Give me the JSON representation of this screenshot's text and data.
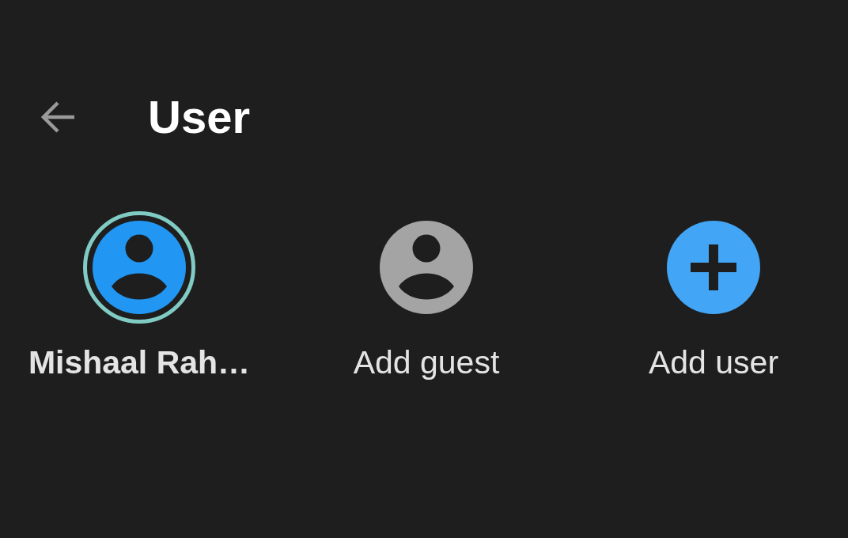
{
  "header": {
    "title": "User"
  },
  "users": [
    {
      "kind": "user",
      "name": "Mishaal Rah…",
      "selected": true
    },
    {
      "kind": "guest",
      "name": "Add guest",
      "selected": false
    },
    {
      "kind": "add",
      "name": "Add user",
      "selected": false
    }
  ]
}
